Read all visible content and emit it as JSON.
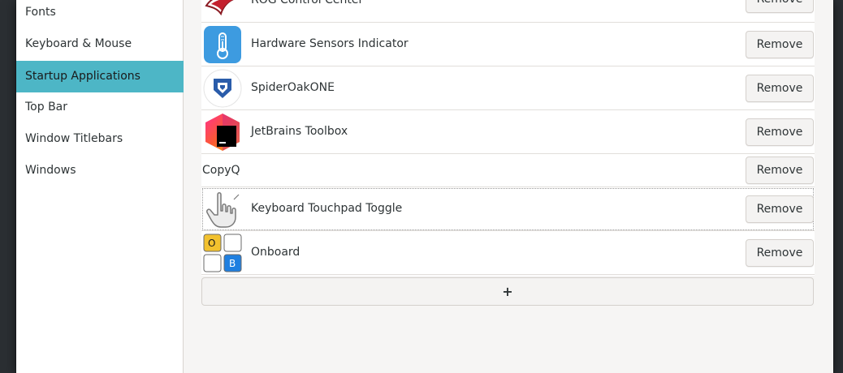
{
  "sidebar": {
    "items": [
      {
        "label": "Fonts"
      },
      {
        "label": "Keyboard & Mouse"
      },
      {
        "label": "Startup Applications",
        "selected": true
      },
      {
        "label": "Top Bar"
      },
      {
        "label": "Window Titlebars"
      },
      {
        "label": "Windows"
      }
    ]
  },
  "startup": {
    "apps": [
      {
        "name": "ROG Control Center",
        "icon": "rog-logo-icon"
      },
      {
        "name": "Hardware Sensors Indicator",
        "icon": "thermometer-icon"
      },
      {
        "name": "SpiderOakONE",
        "icon": "spideroak-icon"
      },
      {
        "name": "JetBrains Toolbox",
        "icon": "jetbrains-toolbox-icon"
      },
      {
        "name": "CopyQ",
        "icon": ""
      },
      {
        "name": "Keyboard Touchpad Toggle",
        "icon": "pointing-hand-icon"
      },
      {
        "name": "Onboard",
        "icon": "onboard-keyboard-icon",
        "icon_letters": [
          "O",
          "B"
        ]
      }
    ],
    "remove_label": "Remove",
    "add_label": "+"
  },
  "colors": {
    "selection": "#4db6c6",
    "thermometer_bg": "#3d9be0",
    "onboard_yellow": "#f2c12e",
    "onboard_blue": "#1f7fe0"
  }
}
